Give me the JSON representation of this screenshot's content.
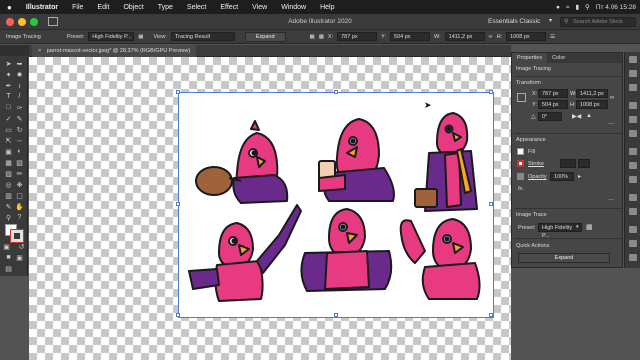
{
  "menubar": {
    "apple": "",
    "app": "Illustrator",
    "items": [
      "File",
      "Edit",
      "Object",
      "Type",
      "Select",
      "Effect",
      "View",
      "Window",
      "Help"
    ],
    "clock": "Пт 4.06  15:28"
  },
  "titlebar": {
    "title": "Adobe Illustrator 2020",
    "workspace": "Essentials Classic",
    "search_placeholder": "Search Adobe Stock"
  },
  "control": {
    "label": "Image Tracing",
    "preset_label": "Preset:",
    "preset_value": "High Fidelity P...",
    "view_label": "View:",
    "view_value": "Tracing Result",
    "expand": "Expand",
    "x_label": "X:",
    "x_value": "787 px",
    "y_label": "Y:",
    "y_value": "504 px",
    "w_label": "W:",
    "w_value": "1411,2 px",
    "h_label": "H:",
    "h_value": "1008 px"
  },
  "document": {
    "tab": "parrot-mascot-vector.jpeg* @ 28,37% (RGB/GPU Preview)"
  },
  "panel": {
    "tabs": [
      "Properties",
      "Color"
    ],
    "section_title": "Image Tracing",
    "transform": "Transform",
    "x_label": "X:",
    "x": "787 px",
    "y_label": "Y:",
    "y": "504 px",
    "w_label": "W:",
    "w": "1411,2 px",
    "h_label": "H:",
    "h": "1008 px",
    "angle": "0°",
    "appearance": "Appearance",
    "fill": "Fill",
    "stroke": "Stroke",
    "opacity": "Opacity",
    "opacity_value": "100%",
    "fx": "fx.",
    "image_trace": "Image Trace",
    "preset_label": "Preset:",
    "preset_value": "High Fidelity P...",
    "quick_actions": "Quick Actions",
    "expand": "Expand"
  },
  "colors": {
    "pink": "#e83a80",
    "purple": "#6a2a8c",
    "orange": "#f5a623",
    "brown": "#a0623a"
  },
  "characters": [
    "parrot-with-baseball-glove",
    "parrot-with-beer",
    "parrot-with-briefcase",
    "parrot-pointing-finger",
    "parrot-with-cape",
    "parrot-waving"
  ]
}
